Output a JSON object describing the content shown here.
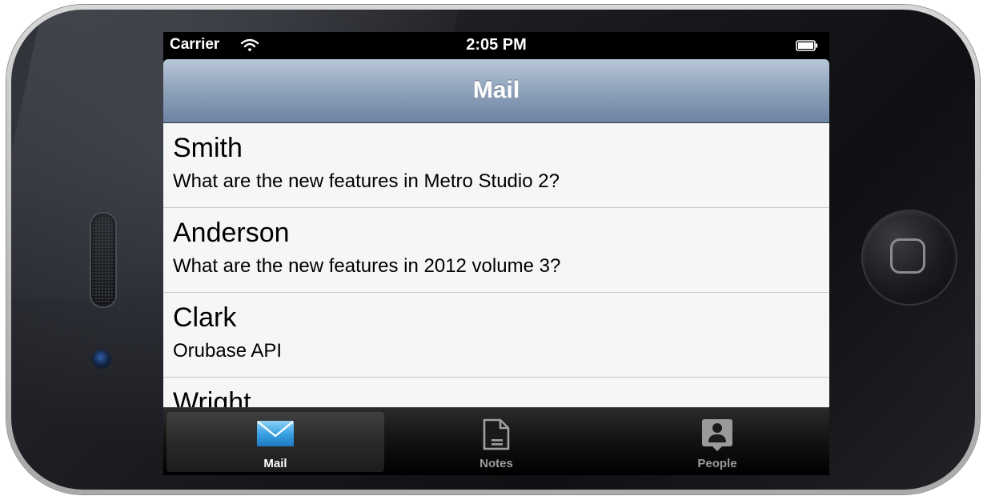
{
  "status_bar": {
    "carrier": "Carrier",
    "time": "2:05 PM",
    "icons": [
      "wifi-icon",
      "battery-icon"
    ]
  },
  "nav_bar": {
    "title": "Mail"
  },
  "mail_list": {
    "items": [
      {
        "sender": "Smith",
        "subject": "What are the new features in Metro Studio 2?"
      },
      {
        "sender": "Anderson",
        "subject": "What are the new features in 2012 volume 3?"
      },
      {
        "sender": "Clark",
        "subject": "Orubase API"
      },
      {
        "sender": "Wright",
        "subject": ""
      }
    ]
  },
  "tab_bar": {
    "tabs": [
      {
        "label": "Mail",
        "icon": "mail-icon",
        "selected": true
      },
      {
        "label": "Notes",
        "icon": "notes-icon",
        "selected": false
      },
      {
        "label": "People",
        "icon": "people-icon",
        "selected": false
      }
    ]
  },
  "colors": {
    "nav_bar_top": "#b8c6d8",
    "nav_bar_bottom": "#6e84a3",
    "list_background": "#f6f6f6",
    "tab_bar_background": "#000000",
    "mail_icon_blue": "#3aa3e3"
  }
}
